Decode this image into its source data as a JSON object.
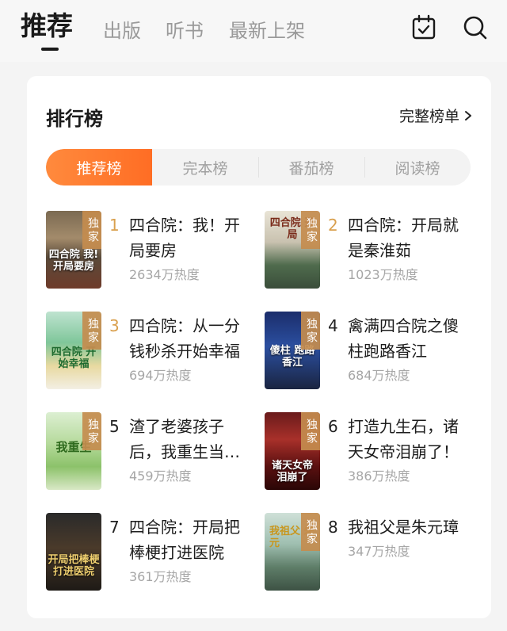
{
  "nav": {
    "tabs": [
      "推荐",
      "出版",
      "听书",
      "最新上架"
    ],
    "active_tab": "推荐",
    "icons": [
      "calendar-check-icon",
      "search-icon"
    ]
  },
  "card": {
    "title": "排行榜",
    "full_list_label": "完整榜单",
    "segments": [
      "推荐榜",
      "完本榜",
      "番茄榜",
      "阅读榜"
    ],
    "active_segment": "推荐榜"
  },
  "books": [
    {
      "rank": "1",
      "title": "四合院：我！开局要房",
      "heat": "2634万热度",
      "badge": "独家",
      "cover_text": "四合院 我!开局要房"
    },
    {
      "rank": "2",
      "title": "四合院：开局就是秦淮茹",
      "heat": "1023万热度",
      "badge": "独家",
      "cover_text": "四合院 开局"
    },
    {
      "rank": "3",
      "title": "四合院：从一分钱秒杀开始幸福",
      "heat": "694万热度",
      "badge": "独家",
      "cover_text": "四合院 开始幸福"
    },
    {
      "rank": "4",
      "title": "禽满四合院之傻柱跑路香江",
      "heat": "684万热度",
      "badge": "独家",
      "cover_text": "傻柱 跑路香江"
    },
    {
      "rank": "5",
      "title": "渣了老婆孩子后，我重生当…",
      "heat": "459万热度",
      "badge": "独家",
      "cover_text": "我重生"
    },
    {
      "rank": "6",
      "title": "打造九生石，诸天女帝泪崩了！",
      "heat": "386万热度",
      "badge": "独家",
      "cover_text": "诸天女帝 泪崩了"
    },
    {
      "rank": "7",
      "title": "四合院：开局把棒梗打进医院",
      "heat": "361万热度",
      "badge": "",
      "cover_text": "开局把棒梗 打进医院"
    },
    {
      "rank": "8",
      "title": "我祖父是朱元璋",
      "heat": "347万热度",
      "badge": "独家",
      "cover_text": "我祖父 朱元"
    }
  ],
  "colors": {
    "accent": "#ff7a2e",
    "rank_top": "#d9a04e",
    "heat": "#a6a6a6",
    "badge": "#c48c4e"
  }
}
